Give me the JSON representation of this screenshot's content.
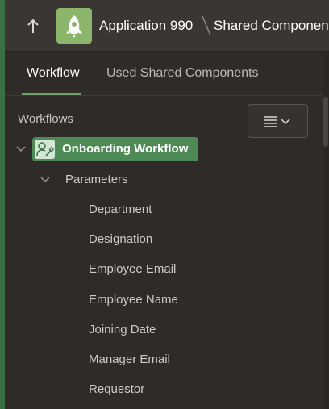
{
  "header": {
    "app_title": "Application 990",
    "breadcrumb": "Shared Components"
  },
  "tabs": [
    {
      "label": "Workflow",
      "active": true
    },
    {
      "label": "Used Shared Components",
      "active": false
    }
  ],
  "tree": {
    "header": "Workflows",
    "workflow": {
      "label": "Onboarding Workflow",
      "parameters_label": "Parameters",
      "parameters": [
        "Department",
        "Designation",
        "Employee Email",
        "Employee Name",
        "Joining Date",
        "Manager Email",
        "Requestor"
      ]
    }
  },
  "colors": {
    "accent": "#4e8a55",
    "app_icon": "#8ab56a",
    "background": "#2e2b29",
    "topbar": "#3a3633"
  },
  "icons": {
    "up": "arrow-up-icon",
    "app": "app-logo-icon",
    "menu": "hamburger-menu-icon",
    "workflow": "workflow-icon"
  }
}
